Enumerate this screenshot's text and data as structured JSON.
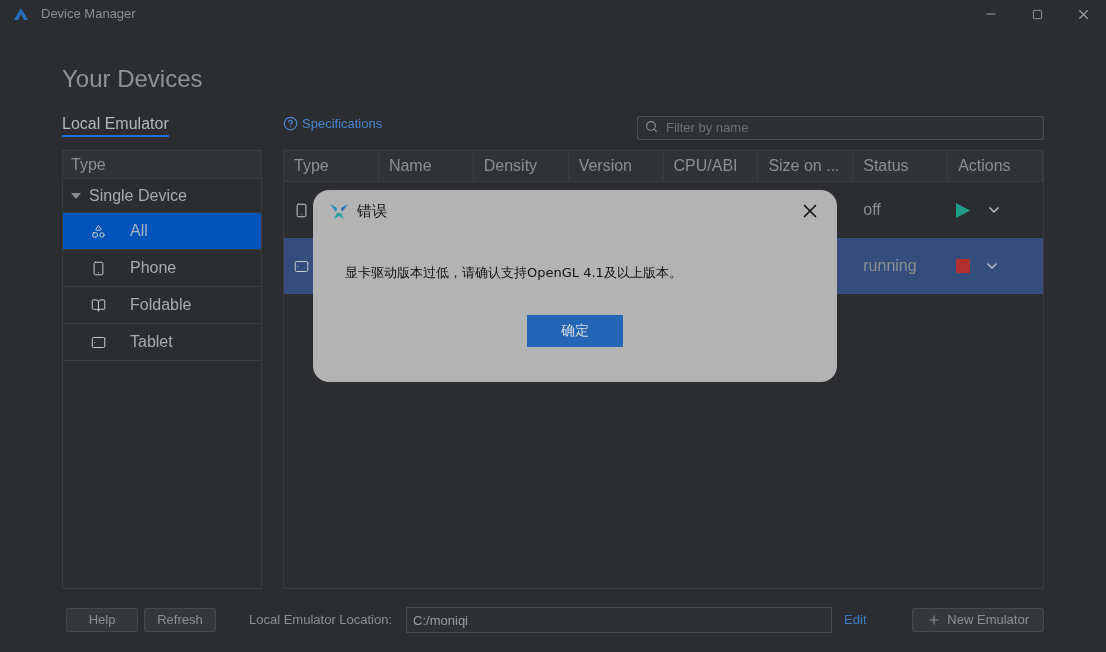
{
  "window": {
    "title": "Device Manager"
  },
  "heading": "Your Devices",
  "tabs": [
    {
      "label": "Local Emulator",
      "selected": true
    }
  ],
  "specifications_link": "Specifications",
  "filter": {
    "placeholder": "Filter by name"
  },
  "type_tree": {
    "header": "Type",
    "items": [
      {
        "label": "Single Device",
        "expanded": true,
        "children": [
          {
            "label": "All",
            "kind": "all",
            "selected": true
          },
          {
            "label": "Phone",
            "kind": "phone",
            "selected": false
          },
          {
            "label": "Foldable",
            "kind": "foldable",
            "selected": false
          },
          {
            "label": "Tablet",
            "kind": "tablet",
            "selected": false
          }
        ]
      }
    ]
  },
  "table": {
    "columns": [
      "Type",
      "Name",
      "Density",
      "Version",
      "CPU/ABI",
      "Size on ...",
      "Status",
      "Actions"
    ],
    "rows": [
      {
        "kind": "phone",
        "status": "off",
        "action": {
          "kind": "start"
        },
        "selected": false
      },
      {
        "kind": "tablet",
        "status": "running",
        "action": {
          "kind": "stop"
        },
        "selected": true
      }
    ]
  },
  "dialog": {
    "title": "错误",
    "message": "显卡驱动版本过低，请确认支持OpenGL 4.1及以上版本。",
    "button": "确定"
  },
  "bottom_bar": {
    "help": "Help",
    "refresh": "Refresh",
    "location_label": "Local Emulator Location:",
    "location_value": "C:/moniqi",
    "edit": "Edit",
    "new_emulator": "New Emulator"
  }
}
